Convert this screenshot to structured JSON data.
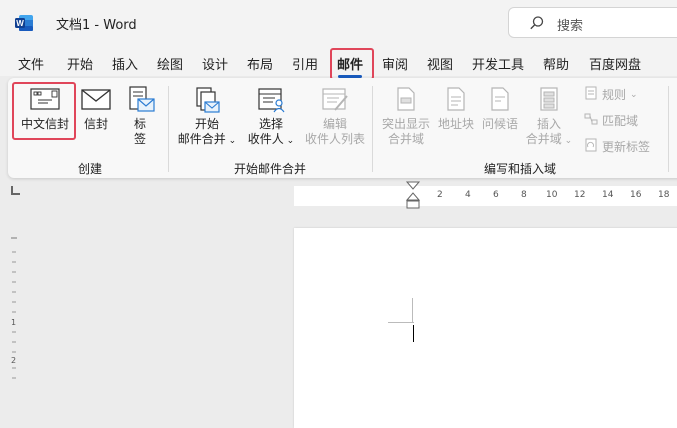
{
  "titlebar": {
    "doc_title": "文档1  -  Word",
    "search_placeholder": "搜索"
  },
  "tabs": [
    "文件",
    "开始",
    "插入",
    "绘图",
    "设计",
    "布局",
    "引用",
    "邮件",
    "审阅",
    "视图",
    "开发工具",
    "帮助",
    "百度网盘"
  ],
  "active_tab": "邮件",
  "ribbon": {
    "create_group": {
      "label": "创建",
      "zh_envelope": "中文信封",
      "envelope": "信封",
      "labels_1": "标",
      "labels_2": "签"
    },
    "start_merge_group": {
      "label": "开始邮件合并",
      "start_merge_1": "开始",
      "start_merge_2": "邮件合并",
      "select_recipients_1": "选择",
      "select_recipients_2": "收件人",
      "edit_recipients_1": "编辑",
      "edit_recipients_2": "收件人列表"
    },
    "write_insert_group": {
      "label": "编写和插入域",
      "highlight_1": "突出显示",
      "highlight_2": "合并域",
      "address_block": "地址块",
      "greeting_line": "问候语",
      "insert_field_1": "插入",
      "insert_field_2": "合并域",
      "rules": "规则",
      "match_fields": "匹配域",
      "update_labels": "更新标签"
    }
  },
  "ruler": {
    "ticks": [
      "2",
      "4",
      "6",
      "8",
      "10",
      "12",
      "14",
      "16",
      "18"
    ]
  },
  "vruler": {
    "tick_1": "1",
    "tick_2": "2"
  },
  "colors": {
    "accent": "#185abd",
    "highlight_box": "#e0465a",
    "word_blue": "#2b5fb8"
  }
}
